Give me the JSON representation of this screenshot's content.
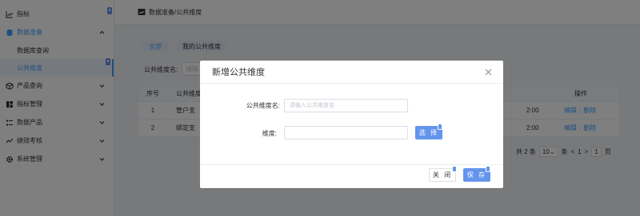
{
  "sidebar": {
    "items": [
      {
        "label": "指标",
        "icon": "chart-line-icon"
      },
      {
        "label": "数据准备",
        "icon": "database-icon"
      },
      {
        "label": "数据库查询",
        "icon": ""
      },
      {
        "label": "公共维度",
        "icon": ""
      },
      {
        "label": "产品查询",
        "icon": "cube-icon"
      },
      {
        "label": "指标管理",
        "icon": "grid-icon"
      },
      {
        "label": "数据产品",
        "icon": "list-icon"
      },
      {
        "label": "绩效考核",
        "icon": "trend-icon"
      },
      {
        "label": "系统管理",
        "icon": "gear-icon"
      }
    ]
  },
  "breadcrumb": {
    "text": "数据准备/公共维度"
  },
  "tabs": [
    {
      "label": "全部"
    },
    {
      "label": "我的公共维度"
    }
  ],
  "filter": {
    "label": "公共维度名:",
    "placeholder": "请输"
  },
  "table": {
    "headers": {
      "no": "序号",
      "name": "公共维度",
      "op": "操作"
    },
    "rows": [
      {
        "no": "1",
        "name": "管户支",
        "time": "2:00",
        "edit": "编辑",
        "delete": "删除"
      },
      {
        "no": "2",
        "name": "绑定支",
        "time": "2:00",
        "edit": "编辑",
        "delete": "删除"
      }
    ]
  },
  "pager": {
    "total": "共 2 条",
    "size": "10",
    "size_unit": "条",
    "prev": "<",
    "page": "1",
    "next": ">",
    "goto": "1",
    "goto_unit": "页"
  },
  "dialog": {
    "title": "新增公共维度",
    "name_label": "公共维度名:",
    "name_placeholder": "请输入公共维度名",
    "dim_label": "维度:",
    "dim_value": "",
    "choose_label": "选 择",
    "close_label": "关 闭",
    "save_label": "保 存"
  },
  "colors": {
    "accent": "#409eff",
    "button": "#6495ed",
    "mask": "rgba(0,0,0,0.5)"
  }
}
